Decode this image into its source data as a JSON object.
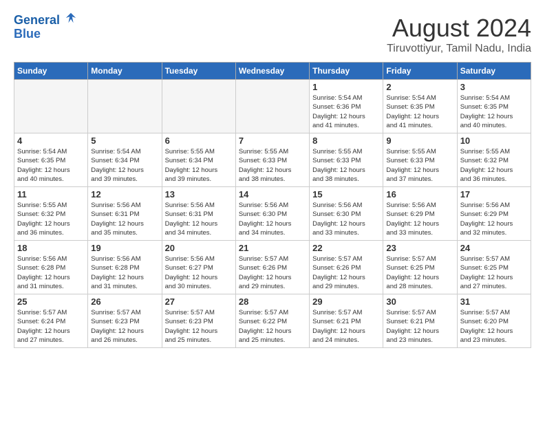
{
  "header": {
    "logo_line1": "General",
    "logo_line2": "Blue",
    "month": "August 2024",
    "location": "Tiruvottiyur, Tamil Nadu, India"
  },
  "weekdays": [
    "Sunday",
    "Monday",
    "Tuesday",
    "Wednesday",
    "Thursday",
    "Friday",
    "Saturday"
  ],
  "weeks": [
    [
      {
        "day": "",
        "info": ""
      },
      {
        "day": "",
        "info": ""
      },
      {
        "day": "",
        "info": ""
      },
      {
        "day": "",
        "info": ""
      },
      {
        "day": "1",
        "info": "Sunrise: 5:54 AM\nSunset: 6:36 PM\nDaylight: 12 hours\nand 41 minutes."
      },
      {
        "day": "2",
        "info": "Sunrise: 5:54 AM\nSunset: 6:35 PM\nDaylight: 12 hours\nand 41 minutes."
      },
      {
        "day": "3",
        "info": "Sunrise: 5:54 AM\nSunset: 6:35 PM\nDaylight: 12 hours\nand 40 minutes."
      }
    ],
    [
      {
        "day": "4",
        "info": "Sunrise: 5:54 AM\nSunset: 6:35 PM\nDaylight: 12 hours\nand 40 minutes."
      },
      {
        "day": "5",
        "info": "Sunrise: 5:54 AM\nSunset: 6:34 PM\nDaylight: 12 hours\nand 39 minutes."
      },
      {
        "day": "6",
        "info": "Sunrise: 5:55 AM\nSunset: 6:34 PM\nDaylight: 12 hours\nand 39 minutes."
      },
      {
        "day": "7",
        "info": "Sunrise: 5:55 AM\nSunset: 6:33 PM\nDaylight: 12 hours\nand 38 minutes."
      },
      {
        "day": "8",
        "info": "Sunrise: 5:55 AM\nSunset: 6:33 PM\nDaylight: 12 hours\nand 38 minutes."
      },
      {
        "day": "9",
        "info": "Sunrise: 5:55 AM\nSunset: 6:33 PM\nDaylight: 12 hours\nand 37 minutes."
      },
      {
        "day": "10",
        "info": "Sunrise: 5:55 AM\nSunset: 6:32 PM\nDaylight: 12 hours\nand 36 minutes."
      }
    ],
    [
      {
        "day": "11",
        "info": "Sunrise: 5:55 AM\nSunset: 6:32 PM\nDaylight: 12 hours\nand 36 minutes."
      },
      {
        "day": "12",
        "info": "Sunrise: 5:56 AM\nSunset: 6:31 PM\nDaylight: 12 hours\nand 35 minutes."
      },
      {
        "day": "13",
        "info": "Sunrise: 5:56 AM\nSunset: 6:31 PM\nDaylight: 12 hours\nand 34 minutes."
      },
      {
        "day": "14",
        "info": "Sunrise: 5:56 AM\nSunset: 6:30 PM\nDaylight: 12 hours\nand 34 minutes."
      },
      {
        "day": "15",
        "info": "Sunrise: 5:56 AM\nSunset: 6:30 PM\nDaylight: 12 hours\nand 33 minutes."
      },
      {
        "day": "16",
        "info": "Sunrise: 5:56 AM\nSunset: 6:29 PM\nDaylight: 12 hours\nand 33 minutes."
      },
      {
        "day": "17",
        "info": "Sunrise: 5:56 AM\nSunset: 6:29 PM\nDaylight: 12 hours\nand 32 minutes."
      }
    ],
    [
      {
        "day": "18",
        "info": "Sunrise: 5:56 AM\nSunset: 6:28 PM\nDaylight: 12 hours\nand 31 minutes."
      },
      {
        "day": "19",
        "info": "Sunrise: 5:56 AM\nSunset: 6:28 PM\nDaylight: 12 hours\nand 31 minutes."
      },
      {
        "day": "20",
        "info": "Sunrise: 5:56 AM\nSunset: 6:27 PM\nDaylight: 12 hours\nand 30 minutes."
      },
      {
        "day": "21",
        "info": "Sunrise: 5:57 AM\nSunset: 6:26 PM\nDaylight: 12 hours\nand 29 minutes."
      },
      {
        "day": "22",
        "info": "Sunrise: 5:57 AM\nSunset: 6:26 PM\nDaylight: 12 hours\nand 29 minutes."
      },
      {
        "day": "23",
        "info": "Sunrise: 5:57 AM\nSunset: 6:25 PM\nDaylight: 12 hours\nand 28 minutes."
      },
      {
        "day": "24",
        "info": "Sunrise: 5:57 AM\nSunset: 6:25 PM\nDaylight: 12 hours\nand 27 minutes."
      }
    ],
    [
      {
        "day": "25",
        "info": "Sunrise: 5:57 AM\nSunset: 6:24 PM\nDaylight: 12 hours\nand 27 minutes."
      },
      {
        "day": "26",
        "info": "Sunrise: 5:57 AM\nSunset: 6:23 PM\nDaylight: 12 hours\nand 26 minutes."
      },
      {
        "day": "27",
        "info": "Sunrise: 5:57 AM\nSunset: 6:23 PM\nDaylight: 12 hours\nand 25 minutes."
      },
      {
        "day": "28",
        "info": "Sunrise: 5:57 AM\nSunset: 6:22 PM\nDaylight: 12 hours\nand 25 minutes."
      },
      {
        "day": "29",
        "info": "Sunrise: 5:57 AM\nSunset: 6:21 PM\nDaylight: 12 hours\nand 24 minutes."
      },
      {
        "day": "30",
        "info": "Sunrise: 5:57 AM\nSunset: 6:21 PM\nDaylight: 12 hours\nand 23 minutes."
      },
      {
        "day": "31",
        "info": "Sunrise: 5:57 AM\nSunset: 6:20 PM\nDaylight: 12 hours\nand 23 minutes."
      }
    ]
  ]
}
